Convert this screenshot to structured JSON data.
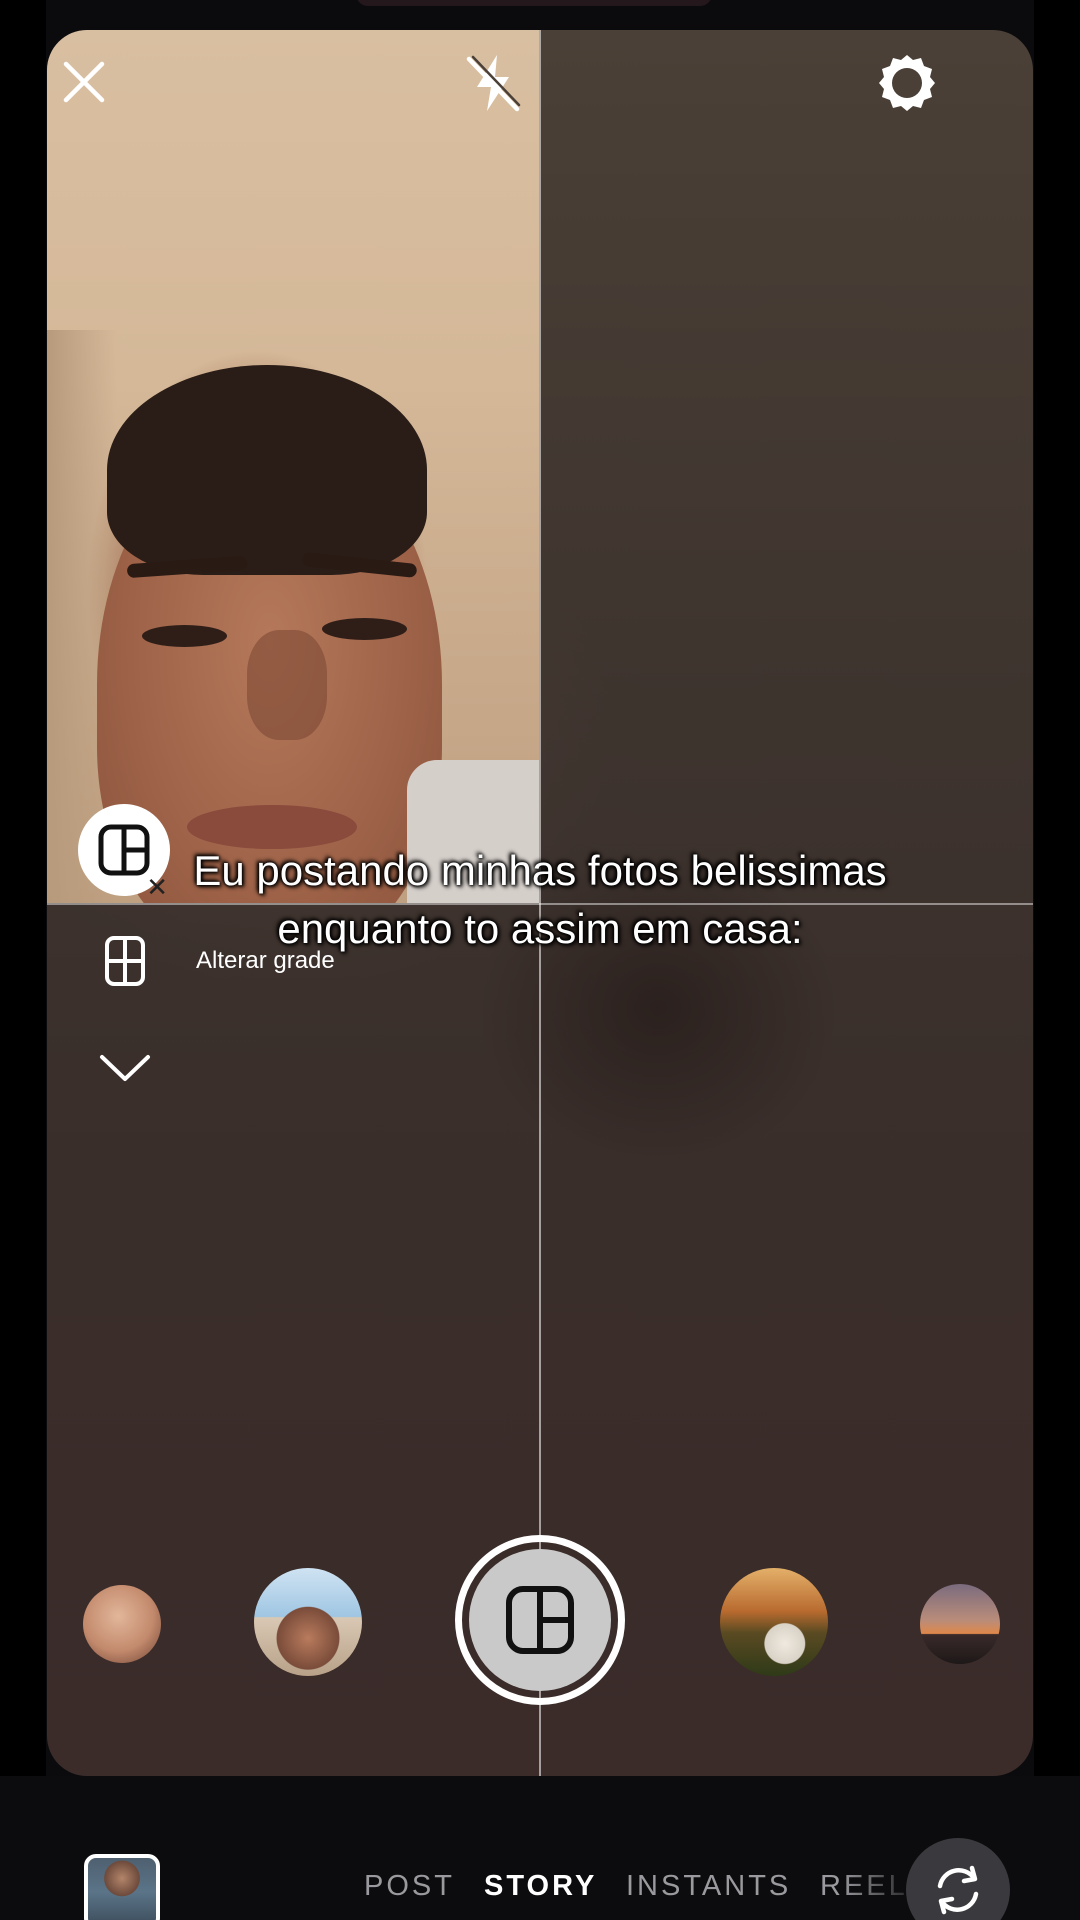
{
  "caption": {
    "line1": "Eu postando minhas fotos belissimas",
    "line2": "enquanto to assim em casa:"
  },
  "top_bar": {
    "close_icon": "close-icon",
    "flash_icon": "flash-off-icon",
    "settings_icon": "settings-icon"
  },
  "side_tools": {
    "layout_icon": "layout-icon",
    "grid_icon": "grid-icon",
    "grid_label": "Alterar grade",
    "collapse_icon": "chevron-down-icon"
  },
  "effects": [
    "effect-1",
    "effect-2",
    "layout-capture",
    "effect-4",
    "effect-5"
  ],
  "modes": {
    "post": "POST",
    "story": "STORY",
    "instants": "INSTANTS",
    "reels": "REELS",
    "active": "STORY"
  },
  "colors": {
    "accent": "#ffffff",
    "inactive_mode": "#9a9a9e",
    "background": "#0c0c0e"
  }
}
